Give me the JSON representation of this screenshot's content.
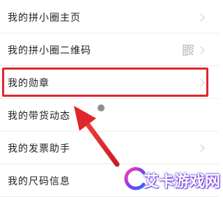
{
  "menu": {
    "items": [
      {
        "label": "我的拼小圈主页"
      },
      {
        "label": "我的拼小圈二维码"
      },
      {
        "label": "我的勋章"
      },
      {
        "label": "我的带货动态"
      },
      {
        "label": "我的发票助手"
      },
      {
        "label": "我的尺码信息"
      }
    ]
  },
  "annotation": {
    "highlight_color": "#e0252b",
    "highlighted_item": "我的勋章"
  },
  "watermark": {
    "text": "艾卡游戏网"
  }
}
